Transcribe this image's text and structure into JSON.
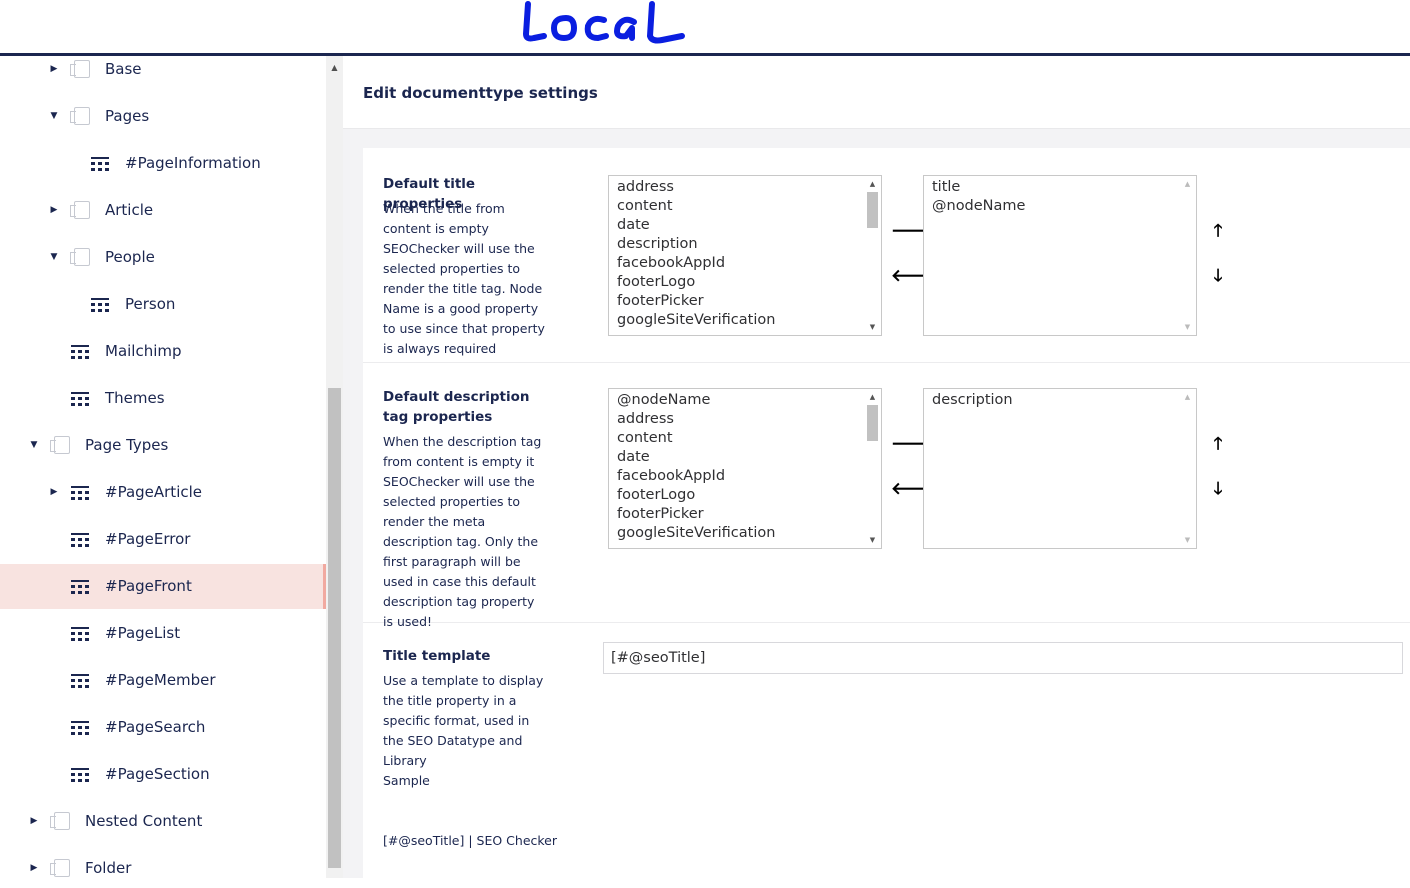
{
  "annotation": {
    "text": "LOCAL"
  },
  "tree": {
    "items": [
      {
        "label": "Base",
        "icon": "folder-icon",
        "caret": "▶"
      },
      {
        "label": "Pages",
        "icon": "folder-icon",
        "caret": "▼"
      },
      {
        "label": "#PageInformation",
        "icon": "doctype-icon",
        "caret": ""
      },
      {
        "label": "Article",
        "icon": "folder-icon",
        "caret": "▶"
      },
      {
        "label": "People",
        "icon": "folder-icon",
        "caret": "▼"
      },
      {
        "label": "Person",
        "icon": "doctype-icon",
        "caret": ""
      },
      {
        "label": "Mailchimp",
        "icon": "doctype-icon",
        "caret": ""
      },
      {
        "label": "Themes",
        "icon": "doctype-icon",
        "caret": ""
      },
      {
        "label": "Page Types",
        "icon": "folder-icon",
        "caret": "▼"
      },
      {
        "label": "#PageArticle",
        "icon": "doctype-icon",
        "caret": "▶"
      },
      {
        "label": "#PageError",
        "icon": "doctype-icon",
        "caret": ""
      },
      {
        "label": "#PageFront",
        "icon": "doctype-icon",
        "caret": "",
        "active": true
      },
      {
        "label": "#PageList",
        "icon": "doctype-icon",
        "caret": ""
      },
      {
        "label": "#PageMember",
        "icon": "doctype-icon",
        "caret": ""
      },
      {
        "label": "#PageSearch",
        "icon": "doctype-icon",
        "caret": ""
      },
      {
        "label": "#PageSection",
        "icon": "doctype-icon",
        "caret": ""
      },
      {
        "label": "Nested Content",
        "icon": "folder-icon",
        "caret": "▶"
      },
      {
        "label": "Folder",
        "icon": "folder-icon",
        "caret": "▶"
      }
    ]
  },
  "page": {
    "title": "Edit documenttype settings"
  },
  "settings": {
    "title_props": {
      "title": "Default title properties",
      "description": "When the title from content is empty SEOChecker will use the selected properties to render the title tag. Node Name is a good property to use since that property is always required",
      "available": [
        "address",
        "content",
        "date",
        "description",
        "facebookAppId",
        "footerLogo",
        "footerPicker",
        "googleSiteVerification"
      ],
      "selected": [
        "title",
        "@nodeName"
      ]
    },
    "description_props": {
      "title": "Default description tag properties",
      "description": "When the description tag from content is empty it SEOChecker will use the selected properties to render the meta description tag. Only the first paragraph will be used in case this default description tag property is used!",
      "available": [
        "@nodeName",
        "address",
        "content",
        "date",
        "facebookAppId",
        "footerLogo",
        "footerPicker",
        "googleSiteVerification"
      ],
      "selected": [
        "description"
      ]
    },
    "title_template": {
      "title": "Title template",
      "description": "Use a template to display the title property in a specific format, used in the SEO Datatype and Library",
      "sample_label": "Sample",
      "sample_value": "[#@seoTitle] | SEO Checker",
      "value": "[#@seoTitle]"
    }
  },
  "icons": {
    "move_right": "arrow-right-icon",
    "move_left": "arrow-left-icon",
    "move_up": "arrow-up-icon",
    "move_down": "arrow-down-icon"
  }
}
